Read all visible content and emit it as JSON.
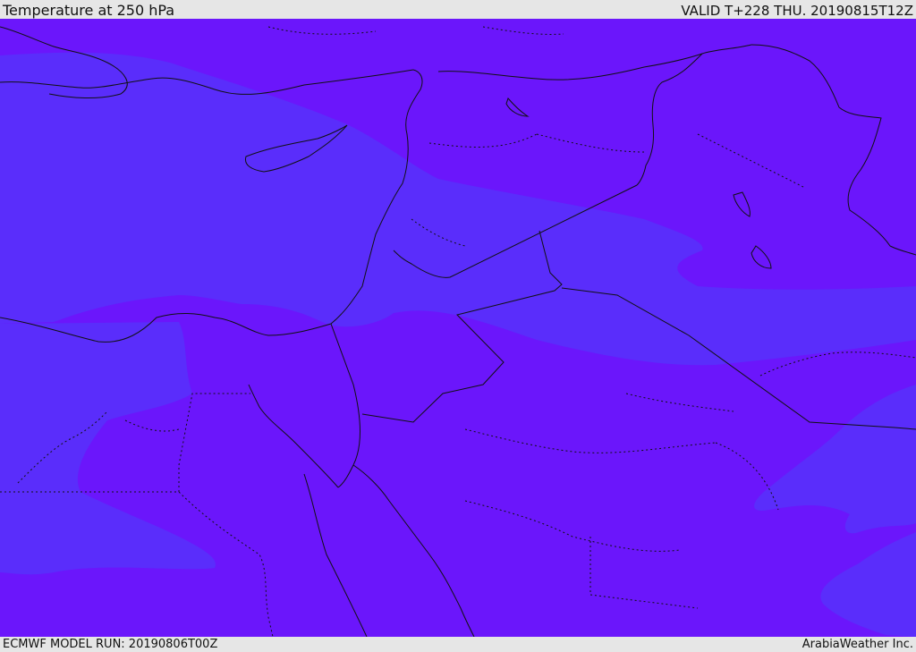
{
  "header": {
    "title": "Temperature at 250 hPa",
    "valid": "VALID T+228 THU. 20190815T12Z"
  },
  "footer": {
    "model_run": "ECMWF MODEL RUN: 20190806T00Z",
    "credit": "ArabiaWeather Inc."
  },
  "map": {
    "colors": {
      "warm_violet": "#6b16fb",
      "cool_blue": "#5a2dfb",
      "border": "#111111"
    }
  }
}
